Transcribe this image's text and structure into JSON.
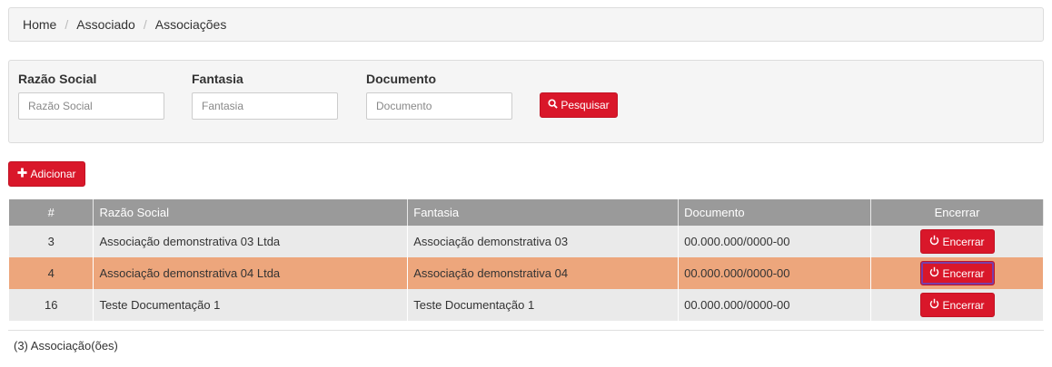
{
  "breadcrumb": {
    "items": [
      "Home",
      "Associado",
      "Associações"
    ],
    "separator": "/"
  },
  "filters": {
    "razao": {
      "label": "Razão Social",
      "placeholder": "Razão Social",
      "value": ""
    },
    "fantasia": {
      "label": "Fantasia",
      "placeholder": "Fantasia",
      "value": ""
    },
    "documento": {
      "label": "Documento",
      "placeholder": "Documento",
      "value": ""
    },
    "search_label": "Pesquisar"
  },
  "toolbar": {
    "add_label": "Adicionar"
  },
  "table": {
    "headers": [
      "#",
      "Razão Social",
      "Fantasia",
      "Documento",
      "Encerrar"
    ],
    "rows": [
      {
        "id": "3",
        "razao": "Associação demonstrativa 03 Ltda",
        "fantasia": "Associação demonstrativa 03",
        "documento": "00.000.000/0000-00",
        "action": "Encerrar"
      },
      {
        "id": "4",
        "razao": "Associação demonstrativa 04 Ltda",
        "fantasia": "Associação demonstrativa 04",
        "documento": "00.000.000/0000-00",
        "action": "Encerrar"
      },
      {
        "id": "16",
        "razao": "Teste Documentação 1",
        "fantasia": "Teste Documentação 1",
        "documento": "00.000.000/0000-00",
        "action": "Encerrar"
      }
    ]
  },
  "footer": {
    "count_text": "(3) Associação(ões)"
  },
  "colors": {
    "accent": "#d9172a",
    "header_bg": "#9a9a9a",
    "row_highlight": "#eda67c"
  },
  "icons": {
    "search": "search-icon",
    "add": "plus-icon",
    "end": "power-icon"
  }
}
